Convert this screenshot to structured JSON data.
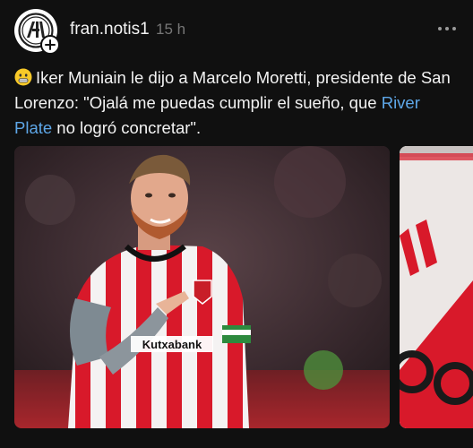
{
  "post": {
    "username": "fran.notis1",
    "time": "15 h",
    "avatar_icon": "club-logo-icon",
    "follow_icon": "plus-icon",
    "more_icon": "more-dots-icon",
    "caption": {
      "emoji": "grimacing-face-emoji",
      "text_before": "Iker Muniain le dijo a Marcelo Moretti, presidente de San Lorenzo: \"Ojalá me puedas cumplir el sueño, que ",
      "link_text": "River Plate",
      "text_after": " no logró concretar\"."
    },
    "media": {
      "main_image": "player-photo",
      "jersey_text": "Kutxabank",
      "second_image": "river-plate-jersey-photo"
    }
  },
  "colors": {
    "background": "#101010",
    "text": "#f3f3f3",
    "muted": "#777777",
    "link": "#5ea7e8",
    "jersey_red": "#d8192a"
  }
}
